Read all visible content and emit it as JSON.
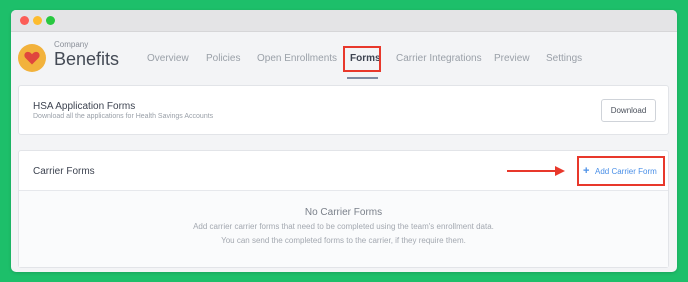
{
  "header": {
    "company_label": "Company",
    "title": "Benefits",
    "logo_icon": "heart-icon"
  },
  "nav": {
    "items": [
      {
        "label": "Overview"
      },
      {
        "label": "Policies"
      },
      {
        "label": "Open Enrollments"
      },
      {
        "label": "Forms",
        "active": true
      },
      {
        "label": "Carrier Integrations"
      },
      {
        "label": "Preview"
      },
      {
        "label": "Settings"
      }
    ]
  },
  "hsa": {
    "title": "HSA Application Forms",
    "subtitle": "Download all the applications for Health Savings Accounts",
    "download_label": "Download"
  },
  "carrier": {
    "title": "Carrier Forms",
    "add_icon": "plus-icon",
    "add_label": "Add Carrier Form",
    "empty_title": "No Carrier Forms",
    "empty_line1": "Add carrier carrier forms that need to be completed using the team's enrollment data.",
    "empty_line2": "You can send the completed forms to the carrier, if they require them."
  },
  "colors": {
    "background": "#1dbf6a",
    "highlight": "#e8382b",
    "accent": "#4a8fe7",
    "logo": "#f2b23c",
    "heart": "#e0463d"
  }
}
